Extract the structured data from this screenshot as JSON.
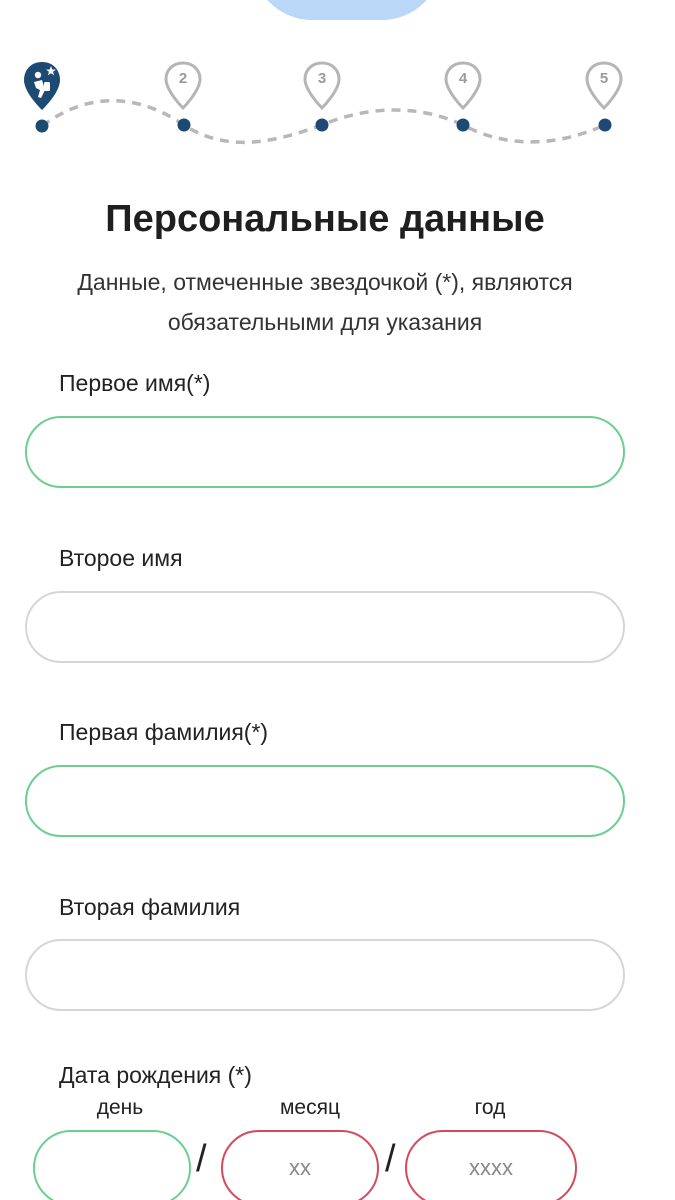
{
  "stepper": {
    "steps": [
      {
        "label": "",
        "state": "active",
        "icon": "traveler-logo-icon"
      },
      {
        "label": "2",
        "state": "pending"
      },
      {
        "label": "3",
        "state": "pending"
      },
      {
        "label": "4",
        "state": "pending"
      },
      {
        "label": "5",
        "state": "pending"
      }
    ],
    "colors": {
      "active": "#1d4a73",
      "pending": "#b5b5b5",
      "dot": "#1d4a73",
      "path": "#b8b8b8"
    }
  },
  "page": {
    "title": "Персональные данные",
    "subtitle_line1": "Данные, отмеченные звездочкой (*), являются",
    "subtitle_line2": "обязательными для указания"
  },
  "form": {
    "first_name": {
      "label": "Первое имя(*)",
      "value": "",
      "required": true
    },
    "middle_name": {
      "label": "Второе имя",
      "value": "",
      "required": false
    },
    "first_surname": {
      "label": "Первая фамилия(*)",
      "value": "",
      "required": true
    },
    "second_surname": {
      "label": "Вторая фамилия",
      "value": "",
      "required": false
    },
    "birth_date": {
      "label": "Дата рождения (*)",
      "day": {
        "caption": "день",
        "value": "",
        "placeholder": ""
      },
      "month": {
        "caption": "месяц",
        "value": "",
        "placeholder": "xx"
      },
      "year": {
        "caption": "год",
        "value": "",
        "placeholder": "xxxx"
      },
      "separator": "/"
    }
  },
  "theme": {
    "valid_border": "#6ccf8e",
    "invalid_border": "#d24a5c",
    "neutral_border": "#d6d6d6",
    "blob": "#b9d8f7"
  }
}
